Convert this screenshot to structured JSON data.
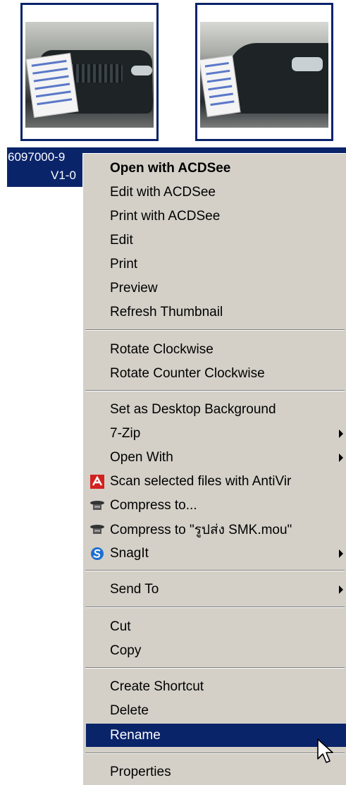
{
  "file": {
    "name_line1": "6097000-9",
    "name_line2": "V1-0"
  },
  "thumbnails": [
    {
      "icon": "car-photo-thumbnail"
    },
    {
      "icon": "car-photo-thumbnail"
    }
  ],
  "menu": {
    "open_acdsee": "Open with ACDSee",
    "edit_acdsee": "Edit with ACDSee",
    "print_acdsee": "Print with ACDSee",
    "edit": "Edit",
    "print": "Print",
    "preview": "Preview",
    "refresh": "Refresh Thumbnail",
    "rotate_cw": "Rotate Clockwise",
    "rotate_ccw": "Rotate Counter Clockwise",
    "desktop_bg": "Set as Desktop Background",
    "zip": "7-Zip",
    "open_with": "Open With",
    "scan": "Scan selected files with AntiVir",
    "compress": "Compress to...",
    "compress_named": "Compress to \"รูปส่ง SMK.mou\"",
    "snagit": "SnagIt",
    "send_to": "Send To",
    "cut": "Cut",
    "copy": "Copy",
    "create_shortcut": "Create Shortcut",
    "delete": "Delete",
    "rename": "Rename",
    "properties": "Properties"
  },
  "colors": {
    "selection": "#0a246a",
    "menu_bg": "#d4d0c8",
    "antivir_red": "#d32020",
    "snagit_blue": "#1e6fd0"
  }
}
